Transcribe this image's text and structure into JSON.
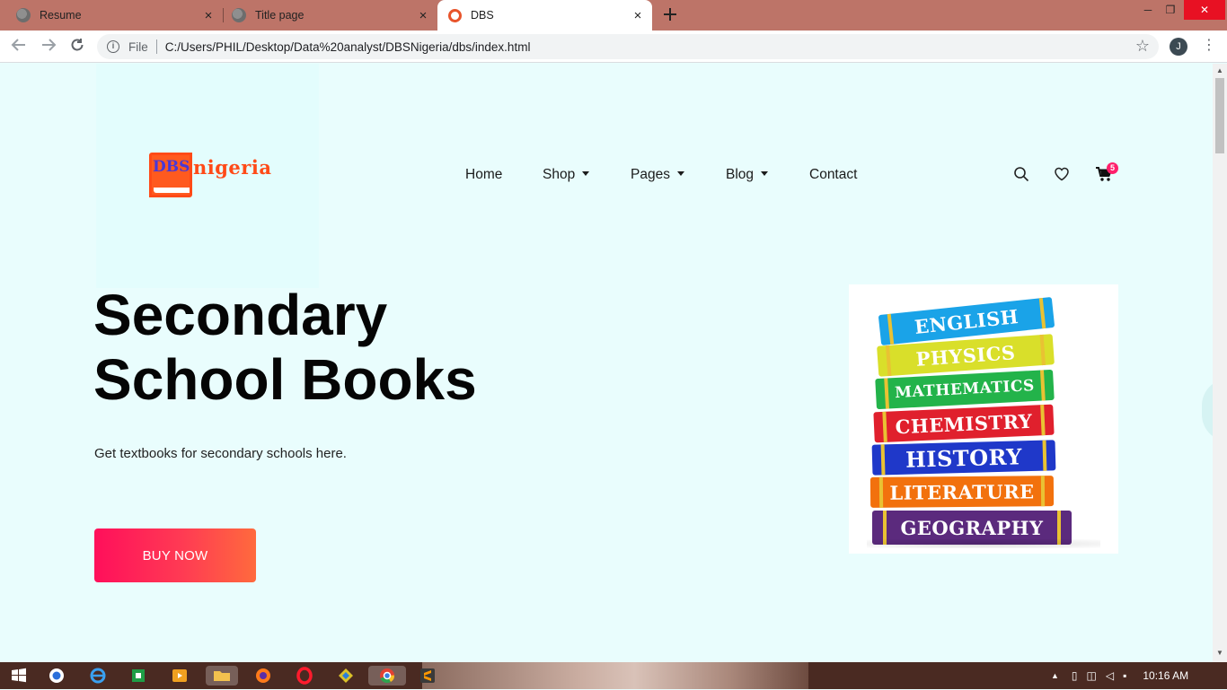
{
  "browser": {
    "tabs": [
      {
        "title": "Resume",
        "active": false
      },
      {
        "title": "Title page",
        "active": false
      },
      {
        "title": "DBS",
        "active": true
      }
    ],
    "address": {
      "scheme_label": "File",
      "url": "C:/Users/PHIL/Desktop/Data%20analyst/DBSNigeria/dbs/index.html"
    },
    "profile_initial": "J",
    "new_tab_icon": "plus-icon",
    "close_icon": "×",
    "window_controls": {
      "minimize": "─",
      "restore": "❐",
      "close": "✕"
    }
  },
  "site": {
    "logo": {
      "part1": "DBS",
      "part2": "nigeria"
    },
    "nav": [
      {
        "label": "Home",
        "dropdown": false
      },
      {
        "label": "Shop",
        "dropdown": true
      },
      {
        "label": "Pages",
        "dropdown": true
      },
      {
        "label": "Blog",
        "dropdown": true
      },
      {
        "label": "Contact",
        "dropdown": false
      }
    ],
    "header_icons": [
      "search-icon",
      "heart-icon",
      "cart-icon"
    ],
    "cart_count": "5",
    "hero": {
      "title_line1": "Secondary",
      "title_line2": "School Books",
      "subtitle": "Get textbooks for secondary schools here.",
      "cta": "BUY NOW"
    },
    "book_stack": [
      {
        "label": "ENGLISH",
        "color": "#1aa3e8"
      },
      {
        "label": "PHYSICS",
        "color": "#d9df2a"
      },
      {
        "label": "MATHEMATICS",
        "color": "#23b34a"
      },
      {
        "label": "CHEMISTRY",
        "color": "#e0202d"
      },
      {
        "label": "HISTORY",
        "color": "#1f38c9"
      },
      {
        "label": "LITERATURE",
        "color": "#f2710d"
      },
      {
        "label": "GEOGRAPHY",
        "color": "#5b2a7d"
      }
    ]
  },
  "taskbar": {
    "clock": "10:16 AM"
  }
}
